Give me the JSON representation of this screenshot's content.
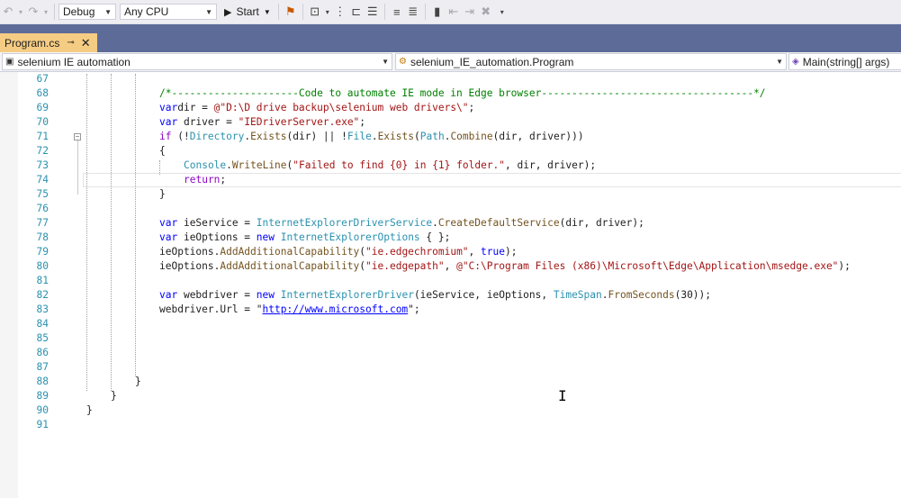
{
  "toolbar": {
    "configuration": "Debug",
    "platform": "Any CPU",
    "start_label": "Start"
  },
  "tab": {
    "title": "Program.cs",
    "pin_glyph": "⊸",
    "close_glyph": "✕"
  },
  "navbar": {
    "project": "selenium IE automation",
    "type": "selenium_IE_automation.Program",
    "member": "Main(string[] args)"
  },
  "editor": {
    "lines": [
      {
        "n": "67",
        "tokens": []
      },
      {
        "n": "68",
        "tokens": [
          [
            "cm",
            "/*---------------------Code to automate IE mode in Edge browser-----------------------------------*/"
          ]
        ]
      },
      {
        "n": "69",
        "tokens": [
          [
            "kw",
            "var"
          ],
          [
            "",
            "dir = "
          ],
          [
            "str",
            "@\"D:\\D drive backup\\selenium web drivers\\\""
          ],
          [
            "",
            ";"
          ]
        ]
      },
      {
        "n": "70",
        "tokens": [
          [
            "kw",
            "var"
          ],
          [
            "",
            " driver = "
          ],
          [
            "str",
            "\"IEDriverServer.exe\""
          ],
          [
            "",
            ";"
          ]
        ]
      },
      {
        "n": "71",
        "tokens": [
          [
            "ctl",
            "if"
          ],
          [
            "",
            " (!"
          ],
          [
            "ty",
            "Directory"
          ],
          [
            "",
            "."
          ],
          [
            "mth",
            "Exists"
          ],
          [
            "",
            "(dir) || !"
          ],
          [
            "ty",
            "File"
          ],
          [
            "",
            "."
          ],
          [
            "mth",
            "Exists"
          ],
          [
            "",
            "("
          ],
          [
            "ty",
            "Path"
          ],
          [
            "",
            "."
          ],
          [
            "mth",
            "Combine"
          ],
          [
            "",
            "(dir, driver)))"
          ]
        ]
      },
      {
        "n": "72",
        "tokens": [
          [
            "",
            "{"
          ]
        ]
      },
      {
        "n": "73",
        "tokens": [
          [
            "ty",
            "Console"
          ],
          [
            "",
            "."
          ],
          [
            "mth",
            "WriteLine"
          ],
          [
            "",
            "("
          ],
          [
            "str",
            "\"Failed to find {0} in {1} folder.\""
          ],
          [
            "",
            ", dir, driver);"
          ]
        ]
      },
      {
        "n": "74",
        "tokens": [
          [
            "ctl",
            "return"
          ],
          [
            "",
            ";"
          ]
        ]
      },
      {
        "n": "75",
        "tokens": [
          [
            "",
            "}"
          ]
        ]
      },
      {
        "n": "76",
        "tokens": []
      },
      {
        "n": "77",
        "tokens": [
          [
            "kw",
            "var"
          ],
          [
            "",
            " ieService = "
          ],
          [
            "ty",
            "InternetExplorerDriverService"
          ],
          [
            "",
            "."
          ],
          [
            "mth",
            "CreateDefaultService"
          ],
          [
            "",
            "(dir, driver);"
          ]
        ]
      },
      {
        "n": "78",
        "tokens": [
          [
            "kw",
            "var"
          ],
          [
            "",
            " ieOptions = "
          ],
          [
            "kw",
            "new"
          ],
          [
            "",
            " "
          ],
          [
            "ty",
            "InternetExplorerOptions"
          ],
          [
            "",
            " { };"
          ]
        ]
      },
      {
        "n": "79",
        "tokens": [
          [
            "",
            "ieOptions."
          ],
          [
            "mth",
            "AddAdditionalCapability"
          ],
          [
            "",
            "("
          ],
          [
            "str",
            "\"ie.edgechromium\""
          ],
          [
            "",
            ", "
          ],
          [
            "kw",
            "true"
          ],
          [
            "",
            ");"
          ]
        ]
      },
      {
        "n": "80",
        "tokens": [
          [
            "",
            "ieOptions."
          ],
          [
            "mth",
            "AddAdditionalCapability"
          ],
          [
            "",
            "("
          ],
          [
            "str",
            "\"ie.edgepath\""
          ],
          [
            "",
            ", "
          ],
          [
            "str",
            "@\"C:\\Program Files (x86)\\Microsoft\\Edge\\Application\\msedge.exe\""
          ],
          [
            "",
            ");"
          ]
        ]
      },
      {
        "n": "81",
        "tokens": []
      },
      {
        "n": "82",
        "tokens": [
          [
            "kw",
            "var"
          ],
          [
            "",
            " webdriver = "
          ],
          [
            "kw",
            "new"
          ],
          [
            "",
            " "
          ],
          [
            "ty",
            "InternetExplorerDriver"
          ],
          [
            "",
            "(ieService, ieOptions, "
          ],
          [
            "ty",
            "TimeSpan"
          ],
          [
            "",
            "."
          ],
          [
            "mth",
            "FromSeconds"
          ],
          [
            "",
            "(30));"
          ]
        ]
      },
      {
        "n": "83",
        "tokens": [
          [
            "",
            "webdriver.Url = \""
          ],
          [
            "lnk",
            "http://www.microsoft.com"
          ],
          [
            "",
            "\";"
          ]
        ]
      },
      {
        "n": "84",
        "tokens": []
      },
      {
        "n": "85",
        "tokens": []
      },
      {
        "n": "86",
        "tokens": []
      },
      {
        "n": "87",
        "tokens": []
      },
      {
        "n": "88",
        "tokens": [
          [
            "",
            "}"
          ]
        ]
      },
      {
        "n": "89",
        "tokens": [
          [
            "",
            "}"
          ]
        ]
      },
      {
        "n": "90",
        "tokens": [
          [
            "",
            "}"
          ]
        ]
      },
      {
        "n": "91",
        "tokens": []
      }
    ]
  }
}
